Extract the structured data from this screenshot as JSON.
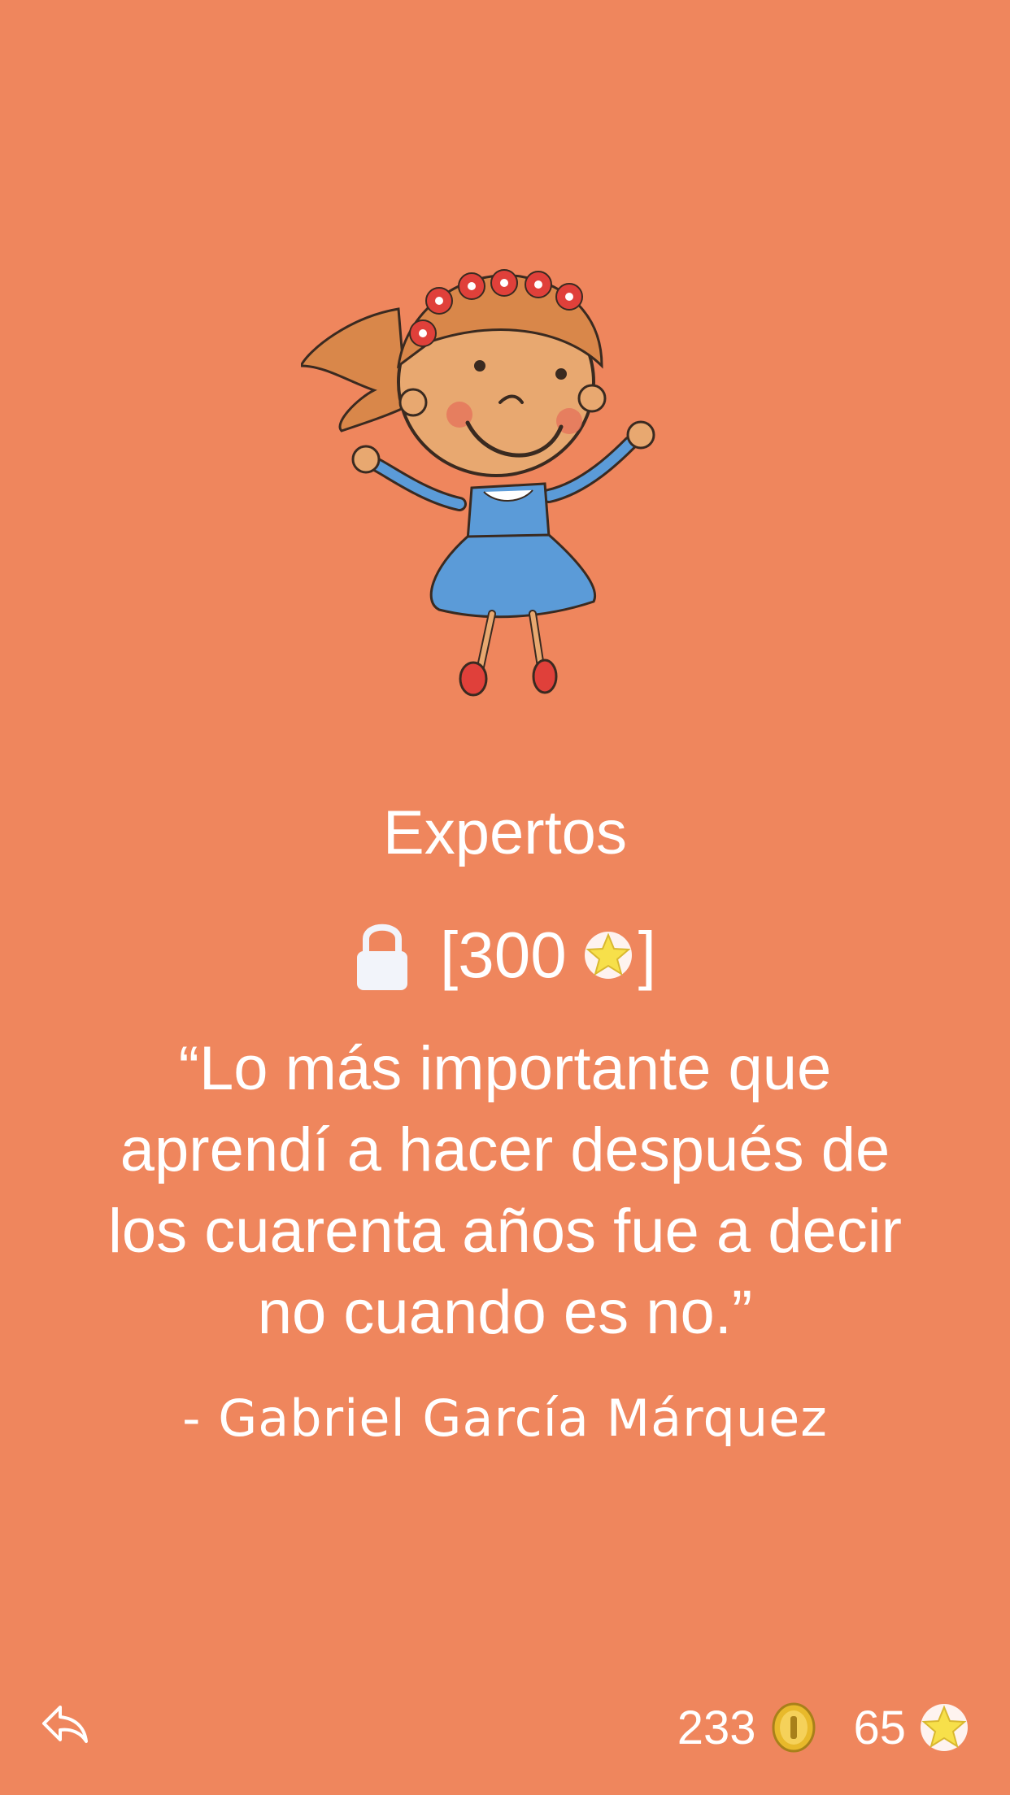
{
  "level": {
    "title": "Expertos",
    "lock_open_bracket": "[300",
    "lock_close_bracket": "]",
    "icons": [
      "lock-icon",
      "star-icon"
    ]
  },
  "quote": {
    "text": "“Lo más importante que aprendí a hacer después de los cuarenta años fue a decir no cuando es no.”",
    "author": "- Gabriel García Márquez"
  },
  "footer": {
    "back_icon": "reply-arrow-icon",
    "coins": "233",
    "stars": "65"
  },
  "colors": {
    "background": "#EF865D",
    "text": "#FFFFFF",
    "star": "#F7E04A",
    "coin": "#E8B92B"
  }
}
